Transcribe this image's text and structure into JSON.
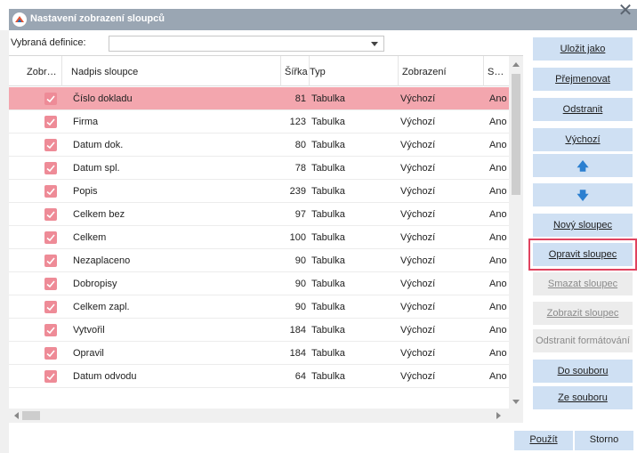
{
  "window": {
    "title": "Nastavení zobrazení sloupců",
    "close_glyph": "✕"
  },
  "definition": {
    "label": "Vybraná definice:",
    "value": ""
  },
  "grid": {
    "headers": [
      "Zobr…",
      "Nadpis sloupce",
      "Šířka",
      "Typ",
      "Zobrazení",
      "S…"
    ],
    "rows": [
      {
        "checked": true,
        "title": "Číslo dokladu",
        "width": "81",
        "type": "Tabulka",
        "display": "Výchozí",
        "s": "Ano"
      },
      {
        "checked": true,
        "title": "Firma",
        "width": "123",
        "type": "Tabulka",
        "display": "Výchozí",
        "s": "Ano"
      },
      {
        "checked": true,
        "title": "Datum dok.",
        "width": "80",
        "type": "Tabulka",
        "display": "Výchozí",
        "s": "Ano"
      },
      {
        "checked": true,
        "title": "Datum spl.",
        "width": "78",
        "type": "Tabulka",
        "display": "Výchozí",
        "s": "Ano"
      },
      {
        "checked": true,
        "title": "Popis",
        "width": "239",
        "type": "Tabulka",
        "display": "Výchozí",
        "s": "Ano"
      },
      {
        "checked": true,
        "title": "Celkem bez",
        "width": "97",
        "type": "Tabulka",
        "display": "Výchozí",
        "s": "Ano"
      },
      {
        "checked": true,
        "title": "Celkem",
        "width": "100",
        "type": "Tabulka",
        "display": "Výchozí",
        "s": "Ano"
      },
      {
        "checked": true,
        "title": "Nezaplaceno",
        "width": "90",
        "type": "Tabulka",
        "display": "Výchozí",
        "s": "Ano"
      },
      {
        "checked": true,
        "title": "Dobropisy",
        "width": "90",
        "type": "Tabulka",
        "display": "Výchozí",
        "s": "Ano"
      },
      {
        "checked": true,
        "title": "Celkem zapl.",
        "width": "90",
        "type": "Tabulka",
        "display": "Výchozí",
        "s": "Ano"
      },
      {
        "checked": true,
        "title": "Vytvořil",
        "width": "184",
        "type": "Tabulka",
        "display": "Výchozí",
        "s": "Ano"
      },
      {
        "checked": true,
        "title": "Opravil",
        "width": "184",
        "type": "Tabulka",
        "display": "Výchozí",
        "s": "Ano"
      },
      {
        "checked": true,
        "title": "Datum odvodu",
        "width": "64",
        "type": "Tabulka",
        "display": "Výchozí",
        "s": "Ano"
      }
    ]
  },
  "side_buttons": {
    "save_as": "Uložit jako",
    "rename": "Přejmenovat",
    "remove": "Odstranit",
    "default": "Výchozí",
    "move_up": "🡅",
    "move_down": "🡇",
    "new_column": "Nový sloupec",
    "edit_column": "Opravit sloupec",
    "delete_column": "Smazat sloupec",
    "show_column": "Zobrazit sloupec",
    "remove_formatting": "Odstranit formátování",
    "to_file": "Do souboru",
    "from_file": "Ze souboru"
  },
  "footer": {
    "apply": "Použít",
    "cancel": "Storno"
  },
  "colors": {
    "selected_row": "#f3a6ae",
    "checkbox": "#ee8b97",
    "button": "#cfe0f3",
    "highlight": "#e0435f",
    "titlebar": "#9aa6b3"
  }
}
